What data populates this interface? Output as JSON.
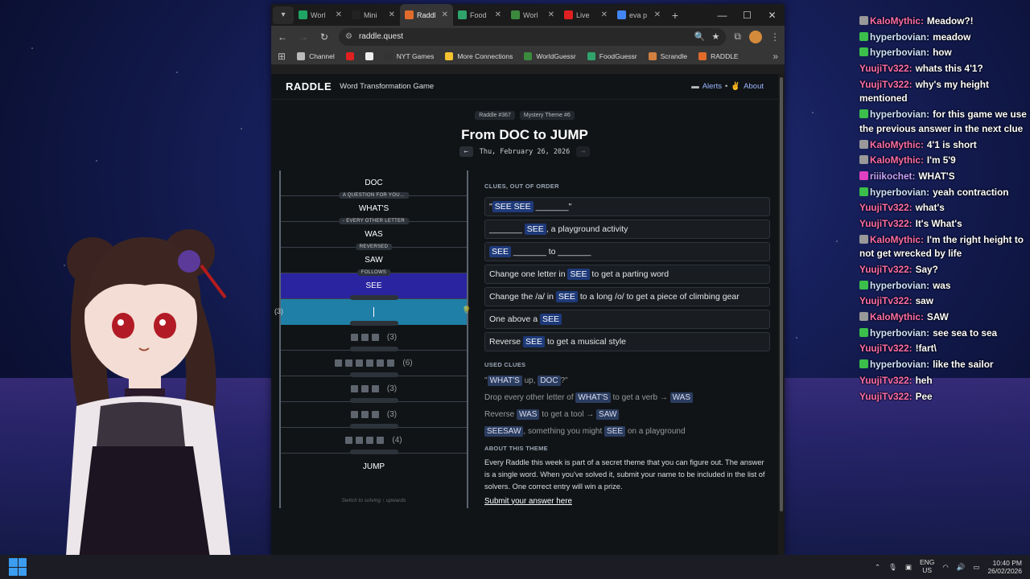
{
  "browser": {
    "tabs": [
      {
        "label": "Worl",
        "icon": "sheet-icon",
        "color": "#1fa463",
        "active": false
      },
      {
        "label": "Mini",
        "icon": "nyt-icon",
        "color": "#222222",
        "active": false
      },
      {
        "label": "Raddl",
        "icon": "raddle-icon",
        "color": "#e06b2b",
        "active": true
      },
      {
        "label": "Food",
        "icon": "globe-icon",
        "color": "#2fa36b",
        "active": false
      },
      {
        "label": "Worl",
        "icon": "globe-icon",
        "color": "#3b8a3e",
        "active": false
      },
      {
        "label": "Live",
        "icon": "youtube-icon",
        "color": "#e02020",
        "active": false
      },
      {
        "label": "eva p",
        "icon": "google-icon",
        "color": "#4285f4",
        "active": false
      }
    ],
    "url": "raddle.quest",
    "bookmarks": [
      {
        "label": "Channel",
        "icon": "folder-icon",
        "color": "#bbbbbb"
      },
      {
        "label": "",
        "icon": "youtube-icon",
        "color": "#e02020"
      },
      {
        "label": "",
        "icon": "x-icon",
        "color": "#eeeeee"
      },
      {
        "label": "NYT Games",
        "icon": "nyt-icon",
        "color": "#333333"
      },
      {
        "label": "More Connections",
        "icon": "grid-icon",
        "color": "#f4c430"
      },
      {
        "label": "WorldGuessr",
        "icon": "globe-icon",
        "color": "#3b8a3e"
      },
      {
        "label": "FoodGuessr",
        "icon": "globe-icon",
        "color": "#2fa36b"
      },
      {
        "label": "Scrandle",
        "icon": "fork-icon",
        "color": "#d08040"
      },
      {
        "label": "RADDLE",
        "icon": "raddle-icon",
        "color": "#e06b2b"
      }
    ]
  },
  "site": {
    "logo": "RADDLE",
    "tagline": "Word Transformation Game",
    "alerts": "Alerts",
    "about": "About",
    "badge1": "Raddle #367",
    "badge2": "Mystery Theme #6",
    "title": "From DOC to JUMP",
    "date": "Thu, February 26, 2026",
    "ladder": {
      "rungs": [
        "DOC",
        "WHAT'S",
        "WAS",
        "SAW",
        "SEE"
      ],
      "hints": [
        "A QUESTION FOR YOU…",
        "- EVERY OTHER LETTER",
        "REVERSED",
        "FOLLOWS"
      ],
      "input_count": "(3)",
      "blanks": [
        {
          "boxes": 3,
          "count": "(3)"
        },
        {
          "boxes": 6,
          "count": "(6)"
        },
        {
          "boxes": 3,
          "count": "(3)"
        },
        {
          "boxes": 3,
          "count": "(3)"
        },
        {
          "boxes": 4,
          "count": "(4)"
        }
      ],
      "last": "JUMP",
      "note": "Switch to solving ↑ upwards"
    },
    "clues_heading": "CLUES, OUT OF ORDER",
    "clues": [
      {
        "pre": "\"",
        "hl": "SEE SEE",
        "post": " _______\""
      },
      {
        "pre": "_______ ",
        "hl": "SEE",
        "post": ", a playground activity"
      },
      {
        "pre": "",
        "hl": "SEE",
        "post": " _______ to _______"
      },
      {
        "pre": "Change one letter in ",
        "hl": "SEE",
        "post": " to get a parting word"
      },
      {
        "pre": "Change the /a/ in ",
        "hl": "SEE",
        "post": " to a long /o/ to get a piece of climbing gear"
      },
      {
        "pre": "One above a ",
        "hl": "SEE",
        "post": ""
      },
      {
        "pre": "Reverse ",
        "hl": "SEE",
        "post": " to get a musical style"
      }
    ],
    "used_heading": "USED CLUES",
    "used": [
      {
        "parts": [
          "\"",
          "WHAT'S",
          " up, ",
          "DOC",
          "?\""
        ]
      },
      {
        "parts": [
          "Drop every other letter of ",
          "WHAT'S",
          " to get a verb → ",
          "WAS",
          ""
        ]
      },
      {
        "parts": [
          "Reverse ",
          "WAS",
          " to get a tool → ",
          "SAW",
          ""
        ]
      },
      {
        "parts": [
          "",
          "SEESAW",
          ", something you might ",
          "SEE",
          " on a playground"
        ]
      }
    ],
    "about_heading": "ABOUT THIS THEME",
    "about_text": "Every Raddle this week is part of a secret theme that you can figure out. The answer is a single word. When you've solved it, submit your name to be included in the list of solvers. One correct entry will win a prize.",
    "about_link": "Submit your answer here"
  },
  "chat": [
    {
      "user": "KaloMythic",
      "cls": "kalo",
      "text": "Meadow?!"
    },
    {
      "user": "hyperbovian",
      "cls": "hyper",
      "text": "meadow"
    },
    {
      "user": "hyperbovian",
      "cls": "hyper",
      "text": "how"
    },
    {
      "user": "YuujiTv322",
      "cls": "yuu",
      "text": "whats this 4'1?"
    },
    {
      "user": "YuujiTv322",
      "cls": "yuu",
      "text": "why's my height mentioned"
    },
    {
      "user": "hyperbovian",
      "cls": "hyper",
      "text": "for this game we use the previous answer in the next clue"
    },
    {
      "user": "KaloMythic",
      "cls": "kalo",
      "text": "4'1 is short"
    },
    {
      "user": "KaloMythic",
      "cls": "kalo",
      "text": "I'm 5'9"
    },
    {
      "user": "riiikochet",
      "cls": "rili",
      "text": "WHAT'S"
    },
    {
      "user": "hyperbovian",
      "cls": "hyper",
      "text": "yeah contraction"
    },
    {
      "user": "YuujiTv322",
      "cls": "yuu",
      "text": "what's"
    },
    {
      "user": "YuujiTv322",
      "cls": "yuu",
      "text": "It's What's"
    },
    {
      "user": "KaloMythic",
      "cls": "kalo",
      "text": "I'm the right height to not get wrecked by life"
    },
    {
      "user": "YuujiTv322",
      "cls": "yuu",
      "text": "Say?"
    },
    {
      "user": "hyperbovian",
      "cls": "hyper",
      "text": "was"
    },
    {
      "user": "YuujiTv322",
      "cls": "yuu",
      "text": "saw"
    },
    {
      "user": "KaloMythic",
      "cls": "kalo",
      "text": "SAW"
    },
    {
      "user": "hyperbovian",
      "cls": "hyper",
      "text": "see sea to sea"
    },
    {
      "user": "YuujiTv322",
      "cls": "yuu",
      "text": "!fart\\"
    },
    {
      "user": "hyperbovian",
      "cls": "hyper",
      "text": "like the sailor"
    },
    {
      "user": "YuujiTv322",
      "cls": "yuu",
      "text": "heh"
    },
    {
      "user": "YuujiTv322",
      "cls": "yuu",
      "text": "Pee"
    }
  ],
  "taskbar": {
    "lang1": "ENG",
    "lang2": "US",
    "time": "10:40 PM",
    "date": "26/02/2026"
  }
}
